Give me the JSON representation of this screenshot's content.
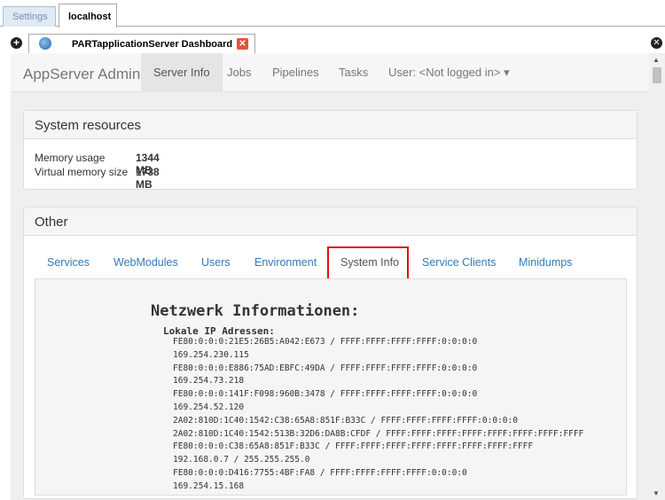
{
  "window_tabs": [
    "Settings",
    "localhost"
  ],
  "doc_tab": {
    "title": "PARTapplicationServer Dashboard"
  },
  "navbar": {
    "brand": "AppServer Admin",
    "items": [
      "Server Info",
      "Jobs",
      "Pipelines",
      "Tasks",
      "User: <Not logged in> ▾"
    ]
  },
  "resources": {
    "title": "System resources",
    "rows": [
      {
        "label": "Memory usage",
        "value": "1344 MB"
      },
      {
        "label": "Virtual memory size",
        "value": "1738 MB"
      }
    ]
  },
  "other": {
    "title": "Other",
    "tabs": [
      "Services",
      "WebModules",
      "Users",
      "Environment",
      "System Info",
      "Service Clients",
      "Minidumps"
    ],
    "active_tab": "System Info"
  },
  "sysinfo": {
    "heading": "Netzwerk Informationen:",
    "subheading": "Lokale IP Adressen:",
    "lines": [
      "FE80:0:0:0:21E5:26B5:A042:E673 / FFFF:FFFF:FFFF:FFFF:0:0:0:0",
      "169.254.230.115",
      "FE80:0:0:0:E886:75AD:EBFC:49DA / FFFF:FFFF:FFFF:FFFF:0:0:0:0",
      "169.254.73.218",
      "FE80:0:0:0:141F:F098:960B:3478 / FFFF:FFFF:FFFF:FFFF:0:0:0:0",
      "169.254.52.120",
      "2A02:810D:1C40:1542:C38:65A8:851F:B33C / FFFF:FFFF:FFFF:FFFF:0:0:0:0",
      "2A02:810D:1C40:1542:513B:32D6:DA8B:CFDF / FFFF:FFFF:FFFF:FFFF:FFFF:FFFF:FFFF:FFFF",
      "FE80:0:0:0:C38:65A8:851F:B33C / FFFF:FFFF:FFFF:FFFF:FFFF:FFFF:FFFF:FFFF",
      "192.168.0.7 / 255.255.255.0",
      "FE80:0:0:0:D416:7755:4BF:FA8 / FFFF:FFFF:FFFF:FFFF:0:0:0:0",
      "169.254.15.168"
    ]
  }
}
